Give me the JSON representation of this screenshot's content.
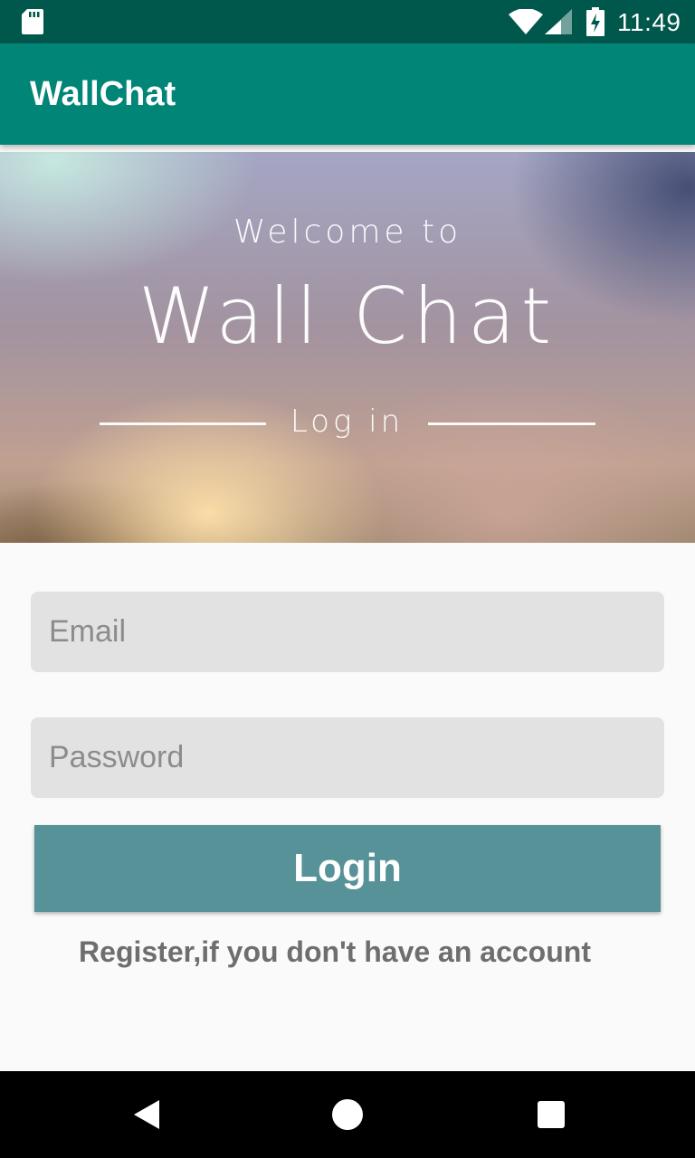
{
  "status_bar": {
    "time": "11:49",
    "icons": [
      "sd-card-icon",
      "wifi-icon",
      "signal-icon",
      "battery-charging-icon"
    ]
  },
  "app_bar": {
    "title": "WallChat"
  },
  "hero": {
    "welcome_text": "Welcome to",
    "brand_text": "Wall Chat",
    "section_text": "Log in"
  },
  "form": {
    "email_placeholder": "Email",
    "email_value": "",
    "password_placeholder": "Password",
    "password_value": "",
    "login_label": "Login",
    "register_text": "Register,if you don't have an account"
  },
  "nav_bar": {
    "icons": [
      "back-icon",
      "home-icon",
      "recents-icon"
    ]
  },
  "colors": {
    "status_bar": "#00574b",
    "app_bar": "#008577",
    "login_button": "#579299",
    "input_background": "#e2e2e2",
    "page_background": "#fafafa"
  }
}
